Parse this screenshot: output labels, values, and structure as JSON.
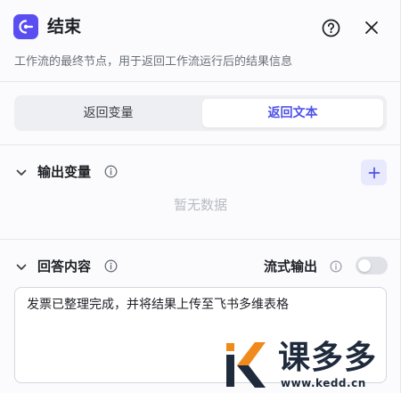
{
  "header": {
    "title": "结束",
    "description": "工作流的最终节点，用于返回工作流运行后的结果信息"
  },
  "return_mode": {
    "options": [
      "返回变量",
      "返回文本"
    ],
    "selected": "返回文本"
  },
  "output_variables": {
    "title": "输出变量",
    "empty_text": "暂无数据"
  },
  "answer_content": {
    "title": "回答内容",
    "stream_label": "流式输出",
    "stream_enabled": false,
    "text": "发票已整理完成，并将结果上传至飞书多维表格"
  },
  "watermark": {
    "name": "课多多",
    "url": "www.kedd.cn"
  },
  "colors": {
    "accent": "#4d53e8",
    "node_icon": "#5b4ef0",
    "watermark_orange": "#f08a1c"
  }
}
